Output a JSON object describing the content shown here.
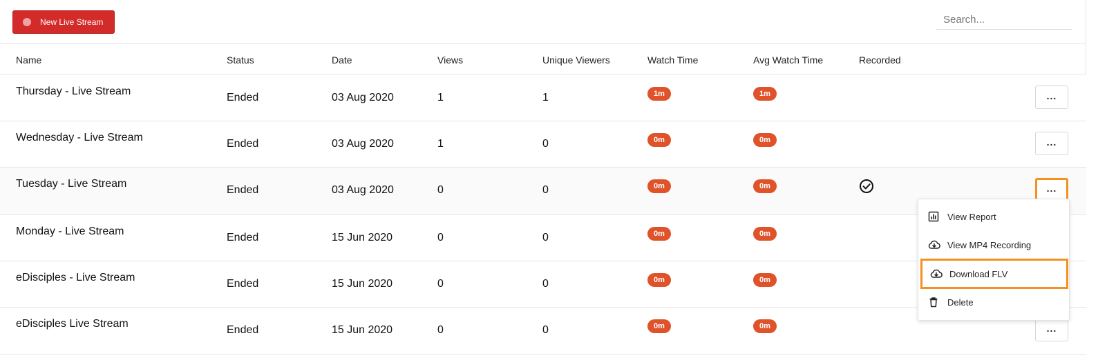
{
  "toolbar": {
    "new_stream_label": "New Live Stream",
    "search_placeholder": "Search..."
  },
  "columns": [
    "Name",
    "Status",
    "Date",
    "Views",
    "Unique Viewers",
    "Watch Time",
    "Avg Watch Time",
    "Recorded"
  ],
  "rows": [
    {
      "name": "Thursday - Live Stream",
      "status": "Ended",
      "date": "03 Aug 2020",
      "views": "1",
      "unique_viewers": "1",
      "watch_time": "1m",
      "avg_watch_time": "1m",
      "recorded": false
    },
    {
      "name": "Wednesday - Live Stream",
      "status": "Ended",
      "date": "03 Aug 2020",
      "views": "1",
      "unique_viewers": "0",
      "watch_time": "0m",
      "avg_watch_time": "0m",
      "recorded": false
    },
    {
      "name": "Tuesday - Live Stream",
      "status": "Ended",
      "date": "03 Aug 2020",
      "views": "0",
      "unique_viewers": "0",
      "watch_time": "0m",
      "avg_watch_time": "0m",
      "recorded": true
    },
    {
      "name": "Monday - Live Stream",
      "status": "Ended",
      "date": "15 Jun 2020",
      "views": "0",
      "unique_viewers": "0",
      "watch_time": "0m",
      "avg_watch_time": "0m",
      "recorded": false
    },
    {
      "name": "eDisciples - Live Stream",
      "status": "Ended",
      "date": "15 Jun 2020",
      "views": "0",
      "unique_viewers": "0",
      "watch_time": "0m",
      "avg_watch_time": "0m",
      "recorded": false
    },
    {
      "name": "eDisciples Live Stream",
      "status": "Ended",
      "date": "15 Jun 2020",
      "views": "0",
      "unique_viewers": "0",
      "watch_time": "0m",
      "avg_watch_time": "0m",
      "recorded": false
    }
  ],
  "more_button_label": "...",
  "context_menu": {
    "items": [
      {
        "label": "View Report",
        "icon": "bar-chart-icon"
      },
      {
        "label": "View MP4 Recording",
        "icon": "cloud-download-icon"
      },
      {
        "label": "Download FLV",
        "icon": "cloud-download-icon"
      },
      {
        "label": "Delete",
        "icon": "trash-icon"
      }
    ]
  },
  "colors": {
    "primary_button": "#d32a2a",
    "pill": "#e0522a",
    "highlight": "#f5901e"
  }
}
